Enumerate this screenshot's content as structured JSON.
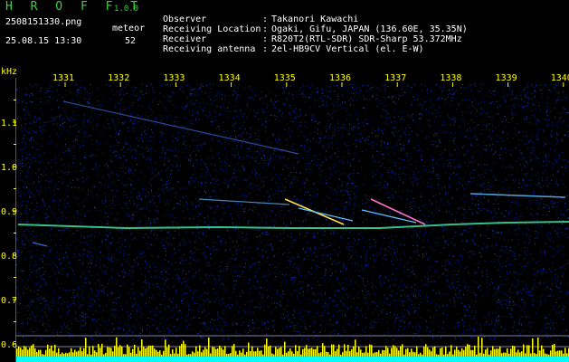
{
  "header": {
    "app_name": "H R O F F T",
    "version": "1.0.0",
    "filename": "2508151330.png",
    "datetime": "25.08.15 13:30",
    "meteor_label": "meteor",
    "meteor_count": "52"
  },
  "info": [
    {
      "label": "Observer",
      "value": "Takanori Kawachi"
    },
    {
      "label": "Receiving Location",
      "value": "Ogaki, Gifu, JAPAN (136.60E, 35.35N)"
    },
    {
      "label": "Receiver",
      "value": "R820T2(RTL-SDR) SDR-Sharp 53.372MHz"
    },
    {
      "label": "Receiving antenna",
      "value": "2el-HB9CV Vertical (el. E-W)"
    }
  ],
  "chart_data": {
    "type": "heatmap",
    "ylabel": "kHz",
    "x_ticks": [
      "1331",
      "1332",
      "1333",
      "1334",
      "1335",
      "1336",
      "1337",
      "1338",
      "1339",
      "1340"
    ],
    "y_ticks": [
      "1.1",
      "1.0",
      "0.9",
      "0.8",
      "0.7",
      "0.6"
    ],
    "ylim": [
      0.6,
      1.2
    ],
    "colors": {
      "background": "#000000",
      "noise": "#0a1a8a",
      "tick_label": "#ffff00",
      "carrier": "#40e0a0",
      "meteor": "#60c0ff",
      "activity": "#ffff00",
      "baseline": "#00ffff"
    }
  }
}
